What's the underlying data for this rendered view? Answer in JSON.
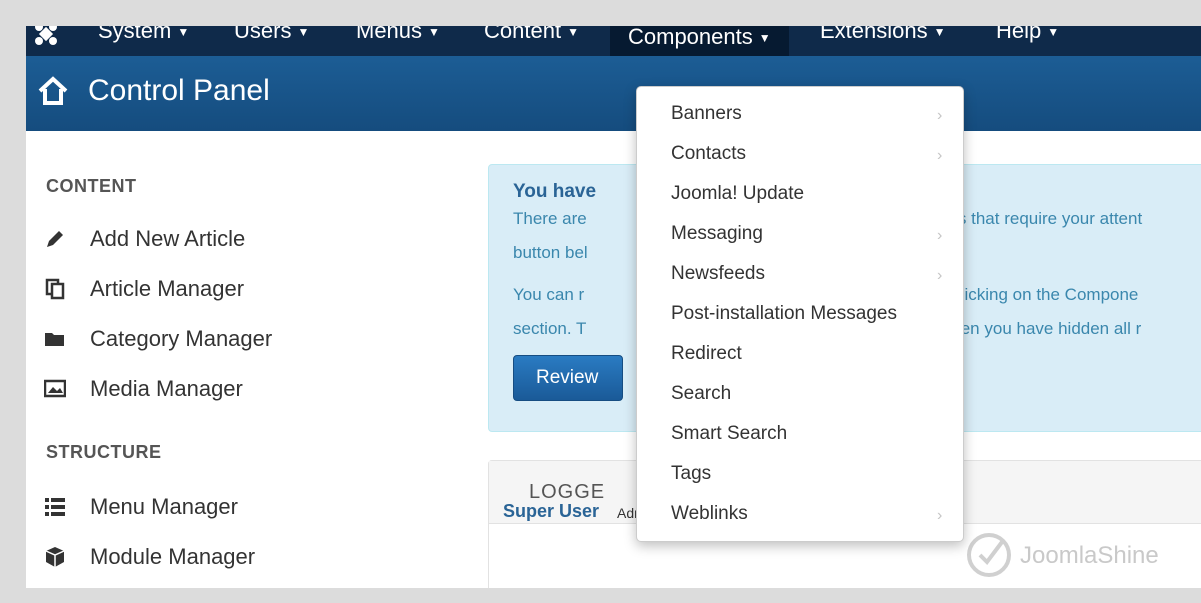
{
  "topnav": {
    "items": [
      {
        "label": "System"
      },
      {
        "label": "Users"
      },
      {
        "label": "Menus"
      },
      {
        "label": "Content"
      },
      {
        "label": "Components"
      },
      {
        "label": "Extensions"
      },
      {
        "label": "Help"
      }
    ],
    "caret": "▼"
  },
  "header": {
    "title": "Control Panel"
  },
  "sidebar": {
    "content_title": "CONTENT",
    "content_items": [
      {
        "label": "Add New Article",
        "icon": "pencil-icon"
      },
      {
        "label": "Article Manager",
        "icon": "copy-icon"
      },
      {
        "label": "Category Manager",
        "icon": "folder-icon"
      },
      {
        "label": "Media Manager",
        "icon": "image-icon"
      }
    ],
    "structure_title": "STRUCTURE",
    "structure_items": [
      {
        "label": "Menu Manager",
        "icon": "list-icon"
      },
      {
        "label": "Module Manager",
        "icon": "cube-icon"
      }
    ]
  },
  "alert": {
    "title": "You have",
    "line1a": "There are",
    "line1b": "ges that require your attent",
    "line2": "button bel",
    "line3a": "You can r",
    "line3b": "y clicking on the Compone",
    "line4a": "section. T",
    "line4b": "when you have hidden all r",
    "button": "Review"
  },
  "logged": {
    "heading": "LOGGE",
    "user": "Super User",
    "role": "Administration"
  },
  "watermark": "JoomlaShine",
  "dropdown": {
    "items": [
      {
        "label": "Banners",
        "submenu": true
      },
      {
        "label": "Contacts",
        "submenu": true
      },
      {
        "label": "Joomla! Update",
        "submenu": false
      },
      {
        "label": "Messaging",
        "submenu": true
      },
      {
        "label": "Newsfeeds",
        "submenu": true
      },
      {
        "label": "Post-installation Messages",
        "submenu": false
      },
      {
        "label": "Redirect",
        "submenu": false
      },
      {
        "label": "Search",
        "submenu": false
      },
      {
        "label": "Smart Search",
        "submenu": false
      },
      {
        "label": "Tags",
        "submenu": false
      },
      {
        "label": "Weblinks",
        "submenu": true
      }
    ],
    "chevron": "›"
  },
  "colors": {
    "nav": "#0f2a4a",
    "header": "#1c5d95",
    "alert_bg": "#d9edf7",
    "link": "#2a6496"
  }
}
